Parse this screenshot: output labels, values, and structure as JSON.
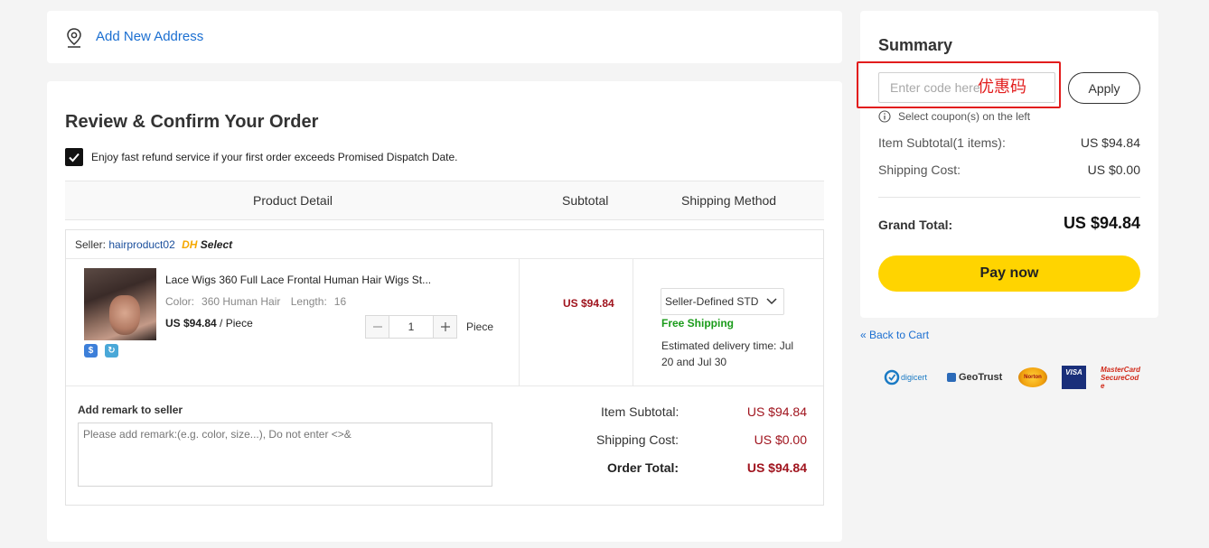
{
  "address": {
    "add_label": "Add New Address"
  },
  "order": {
    "title": "Review & Confirm Your Order",
    "refund_text": "Enjoy fast refund service if your first order exceeds Promised Dispatch Date.",
    "headers": {
      "product": "Product Detail",
      "subtotal": "Subtotal",
      "shipping": "Shipping Method"
    },
    "seller_label": "Seller:",
    "seller_name": "hairproduct02",
    "seller_badge_dh": "DH",
    "seller_badge_select": "Select",
    "item": {
      "title": "Lace Wigs 360 Full Lace Frontal Human Hair Wigs St...",
      "color_label": "Color:",
      "color_value": "360 Human Hair",
      "length_label": "Length:",
      "length_value": "16",
      "price": "US $94.84",
      "unit": " / Piece",
      "quantity": "1",
      "quantity_unit": "Piece",
      "subtotal": "US $94.84",
      "shipping_method": "Seller-Defined STD",
      "free_shipping": "Free Shipping",
      "estimated_delivery": "Estimated delivery time: Jul 20 and Jul 30"
    },
    "remark_label": "Add remark to seller",
    "remark_placeholder": "Please add remark:(e.g. color, size...), Do not enter <>&",
    "item_subtotal_label": "Item Subtotal:",
    "item_subtotal_value": "US $94.84",
    "shipping_cost_label": "Shipping Cost:",
    "shipping_cost_value": "US $0.00",
    "order_total_label": "Order Total:",
    "order_total_value": "US $94.84"
  },
  "summary": {
    "title": "Summary",
    "code_placeholder": "Enter code here",
    "annotation": "优惠码",
    "apply_label": "Apply",
    "coupon_hint": "Select coupon(s) on the left",
    "item_subtotal_label": "Item Subtotal(1 items):",
    "item_subtotal_value": "US $94.84",
    "shipping_cost_label": "Shipping Cost:",
    "shipping_cost_value": "US $0.00",
    "grand_total_label": "Grand Total:",
    "grand_total_value": "US $94.84",
    "pay_label": "Pay now"
  },
  "back_to_cart": "« Back to Cart",
  "trust_logos": [
    "digicert",
    "GeoTrust",
    "Norton",
    "VISA",
    "MasterCard SecureCode"
  ],
  "colors": {
    "link": "#1b6fd1",
    "price_red": "#a0141e",
    "pay_yellow": "#ffd400",
    "free_green": "#1a9b1a",
    "annotation_red": "#e21d1d"
  }
}
